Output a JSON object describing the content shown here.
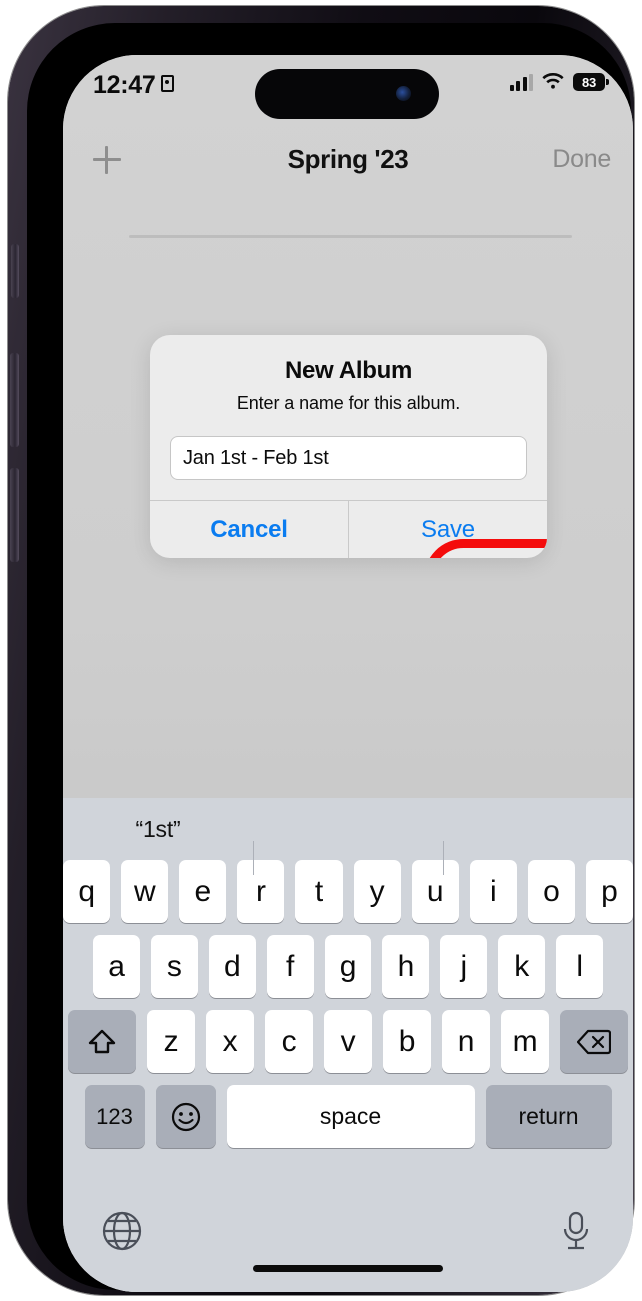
{
  "status_bar": {
    "time": "12:47",
    "location_icon": "location-services-icon",
    "cellular_icon": "cellular-signal-icon",
    "wifi_icon": "wifi-icon",
    "battery_level": "83",
    "battery_icon": "battery-icon"
  },
  "nav_bar": {
    "add_icon": "plus-icon",
    "title": "Spring '23",
    "done_label": "Done",
    "done_color": "#8a8a8a"
  },
  "dialog": {
    "title": "New Album",
    "message": "Enter a name for this album.",
    "input_value": "Jan 1st - Feb 1st",
    "input_placeholder": "Album Name",
    "cancel_label": "Cancel",
    "save_label": "Save",
    "action_color": "#0a7cf0"
  },
  "annotation": {
    "shape": "rounded-rectangle-outline",
    "target": "Save",
    "color": "#f40c0c"
  },
  "keyboard": {
    "predictions": [
      "“1st”",
      "",
      ""
    ],
    "row_top": [
      "q",
      "w",
      "e",
      "r",
      "t",
      "y",
      "u",
      "i",
      "o",
      "p"
    ],
    "row_home": [
      "a",
      "s",
      "d",
      "f",
      "g",
      "h",
      "j",
      "k",
      "l"
    ],
    "row_bottom": [
      "z",
      "x",
      "c",
      "v",
      "b",
      "n",
      "m"
    ],
    "shift_icon": "shift-icon",
    "backspace_icon": "backspace-icon",
    "numeric_label": "123",
    "emoji_icon": "emoji-icon",
    "space_label": "space",
    "return_label": "return",
    "globe_icon": "globe-icon",
    "dictation_icon": "microphone-icon"
  }
}
